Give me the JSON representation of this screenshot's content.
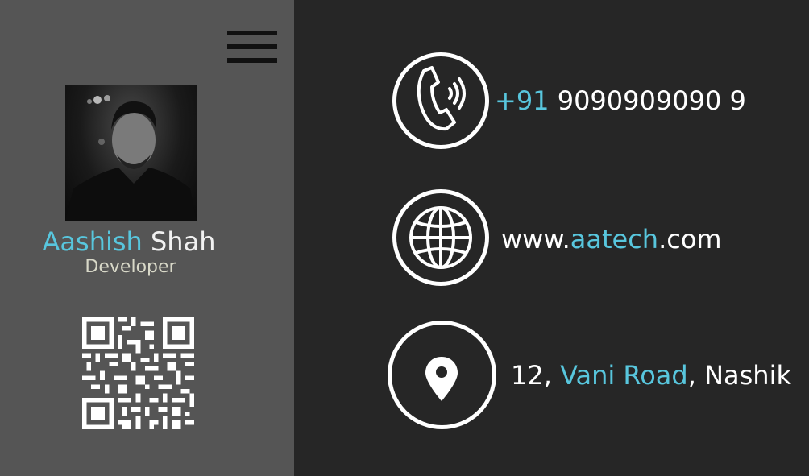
{
  "profile": {
    "first_name": "Aashish",
    "last_name": "Shah",
    "role": "Developer"
  },
  "contact": {
    "phone_prefix": "+91",
    "phone_number": "9090909090 9",
    "website_prefix": "www.",
    "website_domain": "aatech",
    "website_suffix": ".com",
    "address_number": "12,",
    "address_road": "Vani Road",
    "address_city": ", Nashik"
  },
  "icons": {
    "menu": "hamburger-menu-icon",
    "phone": "phone-icon",
    "web": "globe-icon",
    "location": "location-pin-icon",
    "qr": "qr-code"
  },
  "colors": {
    "left_panel": "#555555",
    "right_panel": "#262626",
    "accent": "#58c6dd"
  }
}
